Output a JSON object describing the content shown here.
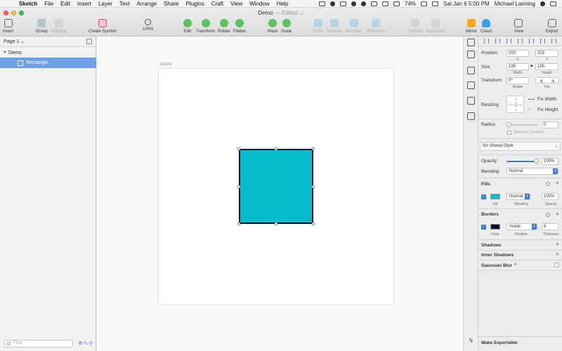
{
  "menubar": {
    "app": "Sketch",
    "items": [
      "File",
      "Edit",
      "Insert",
      "Layer",
      "Text",
      "Arrange",
      "Share",
      "Plugins",
      "Craft",
      "View",
      "Window",
      "Help"
    ],
    "battery": "74%",
    "datetime": "Sat Jan 6  5:00 PM",
    "user": "Michael Lanning"
  },
  "window": {
    "doc_title": "Demo",
    "edited": "— Edited ⌄"
  },
  "toolbar": {
    "insert": "Insert",
    "group": "Group",
    "ungroup": "Ungroup",
    "create_symbol": "Create Symbol",
    "zoom": "100%",
    "edit": "Edit",
    "transform": "Transform",
    "rotate": "Rotate",
    "flatten": "Flatten",
    "mask": "Mask",
    "scale": "Scale",
    "union": "Union",
    "subtract": "Subtract",
    "intersect": "Intersect",
    "difference": "Difference",
    "forward": "Forward",
    "backward": "Backward",
    "mirror": "Mirror",
    "cloud": "Cloud",
    "view": "View",
    "export": "Export"
  },
  "layers": {
    "page": "Page 1 ⌄",
    "artboard": "Demo",
    "rectangle": "Rectangle",
    "filter_placeholder": "Filter"
  },
  "canvas": {
    "artboard_label": "Demo",
    "shape_fill": "#06bccb",
    "shape_border": "#0b0e2e"
  },
  "inspector": {
    "position_label": "Position",
    "x": "203",
    "y": "203",
    "x_label": "X",
    "y_label": "Y",
    "size_label": "Size",
    "width": "195",
    "height": "195",
    "width_label": "Width",
    "height_label": "Height",
    "transform_label": "Transform",
    "rotate_value": "0º",
    "rotate_label": "Rotate",
    "flip_label": "Flip",
    "resizing_label": "Resizing",
    "fix_width": "Fix Width",
    "fix_height": "Fix Height",
    "radius_label": "Radius",
    "radius_value": "0",
    "smooth_corners": "Smooth Corners",
    "shared_style": "No Shared Style",
    "opacity_label": "Opacity",
    "opacity_value": "100%",
    "opacity_level": 1.0,
    "blending_label": "Blending",
    "blending_value": "Normal",
    "fills_label": "Fills",
    "fill_label": "Fill",
    "fill_blend": "Normal",
    "fill_blend_label": "Blending",
    "fill_opacity": "100%",
    "fill_opacity_label": "Opacity",
    "borders_label": "Borders",
    "border_color_label": "Color",
    "border_position": "Inside",
    "border_position_label": "Position",
    "border_thickness": "6",
    "border_thickness_label": "Thickness",
    "shadows_label": "Shadows",
    "inner_shadows_label": "Inner Shadows",
    "gaussian_blur_label": "Gaussian Blur ⌃",
    "make_exportable": "Make Exportable"
  }
}
